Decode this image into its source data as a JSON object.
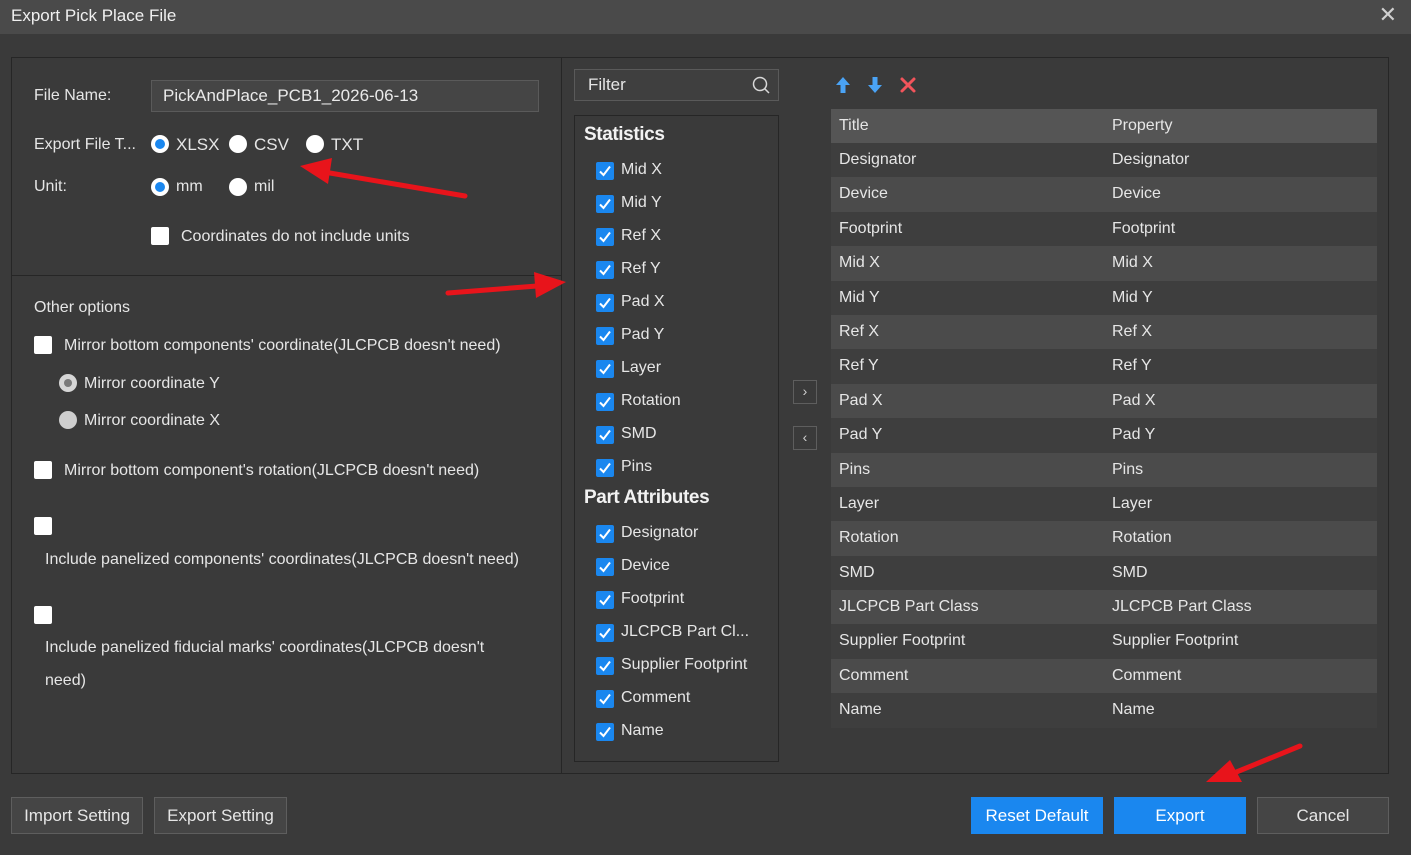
{
  "window": {
    "title": "Export Pick Place File"
  },
  "form": {
    "file_name_label": "File Name:",
    "file_name_value": "PickAndPlace_PCB1_2026-06-13",
    "export_type_label": "Export File T...",
    "export_types": [
      "XLSX",
      "CSV",
      "TXT"
    ],
    "export_type_selected": "XLSX",
    "unit_label": "Unit:",
    "units": [
      "mm",
      "mil"
    ],
    "unit_selected": "mm",
    "no_units_label": "Coordinates do not include units"
  },
  "other_options": {
    "title": "Other options",
    "mirror_coord_label": "Mirror bottom components' coordinate(JLCPCB doesn't need)",
    "mirror_y_label": "Mirror coordinate Y",
    "mirror_x_label": "Mirror coordinate X",
    "mirror_rotation_label": "Mirror bottom component's rotation(JLCPCB doesn't need)",
    "panelized_components_label": "Include panelized components' coordinates(JLCPCB doesn't need)",
    "panelized_fiducial_line1": "Include panelized fiducial marks' coordinates(JLCPCB doesn't",
    "panelized_fiducial_line2": "need)"
  },
  "filter": {
    "placeholder": "Filter"
  },
  "fields": {
    "statistics_title": "Statistics",
    "statistics": [
      "Mid X",
      "Mid Y",
      "Ref X",
      "Ref Y",
      "Pad X",
      "Pad Y",
      "Layer",
      "Rotation",
      "SMD",
      "Pins"
    ],
    "part_attributes_title": "Part Attributes",
    "part_attributes": [
      "Designator",
      "Device",
      "Footprint",
      "JLCPCB Part Cl...",
      "Supplier Footprint",
      "Comment",
      "Name"
    ]
  },
  "move": {
    "right": "›",
    "left": "‹"
  },
  "table": {
    "headers": [
      "Title",
      "Property"
    ],
    "rows": [
      [
        "Designator",
        "Designator"
      ],
      [
        "Device",
        "Device"
      ],
      [
        "Footprint",
        "Footprint"
      ],
      [
        "Mid X",
        "Mid X"
      ],
      [
        "Mid Y",
        "Mid Y"
      ],
      [
        "Ref X",
        "Ref X"
      ],
      [
        "Ref Y",
        "Ref Y"
      ],
      [
        "Pad X",
        "Pad X"
      ],
      [
        "Pad Y",
        "Pad Y"
      ],
      [
        "Pins",
        "Pins"
      ],
      [
        "Layer",
        "Layer"
      ],
      [
        "Rotation",
        "Rotation"
      ],
      [
        "SMD",
        "SMD"
      ],
      [
        "JLCPCB Part Class",
        "JLCPCB Part Class"
      ],
      [
        "Supplier Footprint",
        "Supplier Footprint"
      ],
      [
        "Comment",
        "Comment"
      ],
      [
        "Name",
        "Name"
      ]
    ]
  },
  "buttons": {
    "import_setting": "Import Setting",
    "export_setting": "Export Setting",
    "reset_default": "Reset Default",
    "export": "Export",
    "cancel": "Cancel"
  },
  "colors": {
    "accent": "#1a87ef",
    "annotation_arrow": "#e8141b"
  }
}
